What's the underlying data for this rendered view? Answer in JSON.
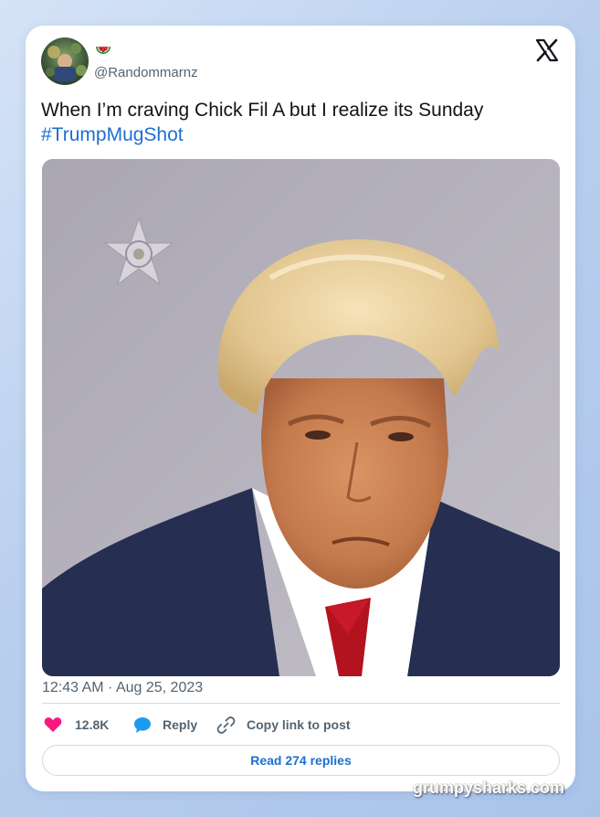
{
  "tweet": {
    "handle": "@Randommarnz",
    "text": "When I’m craving Chick Fil A but I realize its Sunday",
    "hashtag": "#TrumpMugShot",
    "timestamp": "12:43 AM · Aug 25, 2023"
  },
  "actions": {
    "like_count": "12.8K",
    "reply_label": "Reply",
    "copy_label": "Copy link to post",
    "read_replies_label": "Read 274 replies"
  },
  "icons": {
    "display_name_emoji": "watermelon-icon",
    "platform": "x-logo-icon",
    "like": "heart-icon",
    "reply": "speech-bubble-icon",
    "copy": "link-icon"
  },
  "colors": {
    "hashtag": "#1d6fd1",
    "like_heart": "#f91880",
    "reply_bubble": "#1d9bf0",
    "link_text": "#1d6fd1"
  },
  "watermark": "grumpysharks.com"
}
